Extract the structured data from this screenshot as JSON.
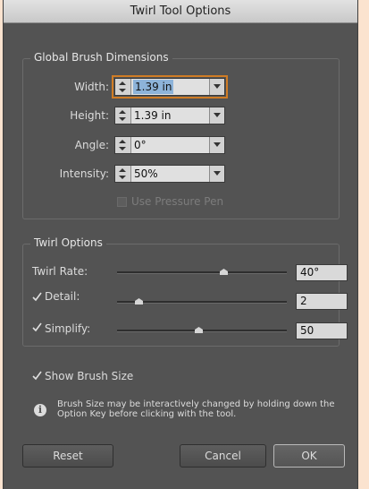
{
  "title": "Twirl Tool Options",
  "global": {
    "title": "Global Brush Dimensions",
    "width": {
      "label": "Width:",
      "value": "1.39 in"
    },
    "height": {
      "label": "Height:",
      "value": "1.39 in"
    },
    "angle": {
      "label": "Angle:",
      "value": "0°"
    },
    "intensity": {
      "label": "Intensity:",
      "value": "50%"
    },
    "pressure": {
      "label": "Use Pressure Pen",
      "checked": false,
      "enabled": false
    }
  },
  "twirl": {
    "title": "Twirl Options",
    "rate": {
      "label": "Twirl Rate:",
      "value": "40°",
      "level": 0.63
    },
    "detail": {
      "label": "Detail:",
      "value": "2",
      "checked": true,
      "level": 0.13
    },
    "simplify": {
      "label": "Simplify:",
      "value": "50",
      "checked": true,
      "level": 0.48
    }
  },
  "show_brush_size": {
    "label": "Show Brush Size",
    "checked": true
  },
  "info": {
    "line1": "Brush Size may be interactively changed by holding down the",
    "line2": "Option Key before clicking with the tool."
  },
  "buttons": {
    "reset": "Reset",
    "cancel": "Cancel",
    "ok": "OK"
  },
  "colors": {
    "background": "#535353",
    "focus": "#d07c25",
    "selection": "#8db3d9"
  }
}
